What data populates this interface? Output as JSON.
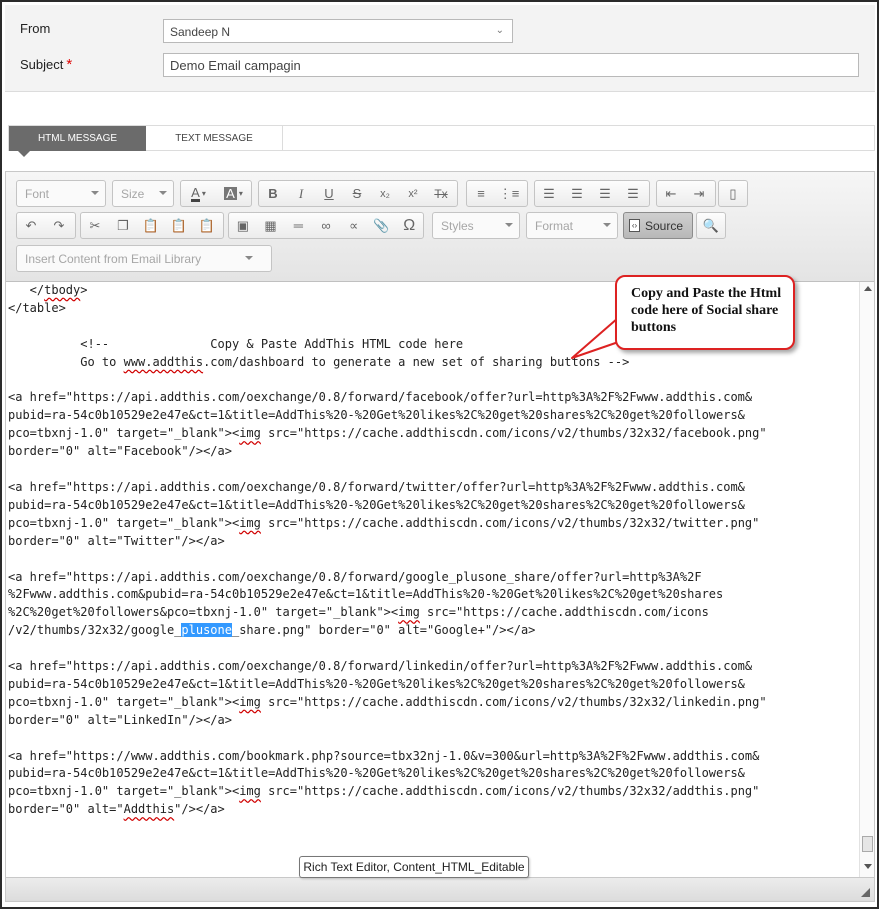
{
  "form": {
    "from_label": "From",
    "from_value": "Sandeep N",
    "subject_label": "Subject",
    "subject_required_marker": "*",
    "subject_value": "Demo Email campagin"
  },
  "tabs": [
    {
      "label": "HTML MESSAGE",
      "active": true
    },
    {
      "label": "TEXT MESSAGE",
      "active": false
    }
  ],
  "toolbar": {
    "font": "Font",
    "size": "Size",
    "styles": "Styles",
    "format": "Format",
    "source": "Source",
    "insert_library": "Insert Content from Email Library",
    "text_color_letter": "A",
    "bg_color_letter": "A",
    "bold": "B",
    "italic": "I",
    "underline": "U",
    "strike": "S",
    "subscript": "x₂",
    "superscript": "x²",
    "remove_format": "Tx",
    "special_char": "Ω"
  },
  "code_lines": [
    {
      "pre": "   </",
      "w": "tbody",
      "post": ">"
    },
    {
      "pre": "</table>"
    },
    {
      "pre": ""
    },
    {
      "pre": "          <!--              Copy & Paste AddThis HTML code here"
    },
    {
      "pre": "          Go to ",
      "w": "www.addthis",
      "post": ".com/dashboard to generate a new set of sharing buttons -->"
    },
    {
      "pre": ""
    },
    {
      "pre": "<a href=\"https://api.addthis.com/oexchange/0.8/forward/facebook/offer?url=http%3A%2F%2Fwww.addthis.com&"
    },
    {
      "pre": "pubid=ra-54c0b10529e2e47e&ct=1&title=AddThis%20-%20Get%20likes%2C%20get%20shares%2C%20get%20followers&"
    },
    {
      "pre": "pco=tbxnj-1.0\" target=\"_blank\"><",
      "w": "img",
      "post": " src=\"https://cache.addthiscdn.com/icons/v2/thumbs/32x32/facebook.png\""
    },
    {
      "pre": "border=\"0\" alt=\"Facebook\"/></a>"
    },
    {
      "pre": ""
    },
    {
      "pre": "<a href=\"https://api.addthis.com/oexchange/0.8/forward/twitter/offer?url=http%3A%2F%2Fwww.addthis.com&"
    },
    {
      "pre": "pubid=ra-54c0b10529e2e47e&ct=1&title=AddThis%20-%20Get%20likes%2C%20get%20shares%2C%20get%20followers&"
    },
    {
      "pre": "pco=tbxnj-1.0\" target=\"_blank\"><",
      "w": "img",
      "post": " src=\"https://cache.addthiscdn.com/icons/v2/thumbs/32x32/twitter.png\""
    },
    {
      "pre": "border=\"0\" alt=\"Twitter\"/></a>"
    },
    {
      "pre": ""
    },
    {
      "pre": "<a href=\"https://api.addthis.com/oexchange/0.8/forward/google_plusone_share/offer?url=http%3A%2F"
    },
    {
      "pre": "%2Fwww.addthis.com&pubid=ra-54c0b10529e2e47e&ct=1&title=AddThis%20-%20Get%20likes%2C%20get%20shares"
    },
    {
      "pre": "%2C%20get%20followers&pco=tbxnj-1.0\" target=\"_blank\"><",
      "w": "img",
      "post": " src=\"https://cache.addthiscdn.com/icons"
    },
    {
      "pre": "/v2/thumbs/32x32/google_",
      "h": "plusone",
      "post": "_share.png\" border=\"0\" alt=\"Google+\"/></a>"
    },
    {
      "pre": ""
    },
    {
      "pre": "<a href=\"https://api.addthis.com/oexchange/0.8/forward/linkedin/offer?url=http%3A%2F%2Fwww.addthis.com&"
    },
    {
      "pre": "pubid=ra-54c0b10529e2e47e&ct=1&title=AddThis%20-%20Get%20likes%2C%20get%20shares%2C%20get%20followers&"
    },
    {
      "pre": "pco=tbxnj-1.0\" target=\"_blank\"><",
      "w": "img",
      "post": " src=\"https://cache.addthiscdn.com/icons/v2/thumbs/32x32/linkedin.png\""
    },
    {
      "pre": "border=\"0\" alt=\"LinkedIn\"/></a>"
    },
    {
      "pre": ""
    },
    {
      "pre": "<a href=\"https://www.addthis.com/bookmark.php?source=tbx32nj-1.0&v=300&url=http%3A%2F%2Fwww.addthis.com&"
    },
    {
      "pre": "pubid=ra-54c0b10529e2e47e&ct=1&title=AddThis%20-%20Get%20likes%2C%20get%20shares%2C%20get%20followers&"
    },
    {
      "pre": "pco=tbxnj-1.0\" target=\"_blank\"><",
      "w": "img",
      "post": " src=\"https://cache.addthiscdn.com/icons/v2/thumbs/32x32/addthis.png\""
    },
    {
      "pre": "border=\"0\" alt=\"",
      "w": "Addthis",
      "post": "\"/></a>"
    }
  ],
  "tooltip": "Rich Text Editor, Content_HTML_Editable",
  "callout": "Copy and Paste the Html code here of Social share buttons",
  "colors": {
    "active_tab": "#6b6b6b",
    "callout_border": "#dd2222",
    "selection": "#3399ff"
  }
}
